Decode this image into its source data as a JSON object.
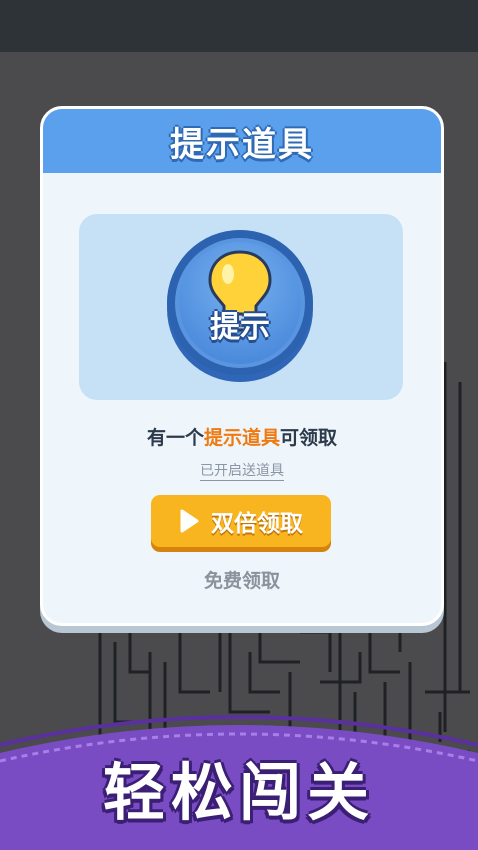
{
  "dialog": {
    "title": "提示道具",
    "item_label": "提示",
    "message_prefix": "有一个",
    "message_highlight": "提示道具",
    "message_suffix": "可领取",
    "toggle_text": "已开启送道具",
    "double_button_label": "双倍领取",
    "free_button_label": "免费领取"
  },
  "banner": {
    "text": "轻松闯关"
  },
  "colors": {
    "header_blue": "#5aa0ec",
    "highlight_orange": "#f07a12",
    "button_yellow": "#f9b520",
    "banner_purple": "#7a4cc4"
  },
  "icons": {
    "item": "lightbulb-icon",
    "button": "play-icon"
  }
}
